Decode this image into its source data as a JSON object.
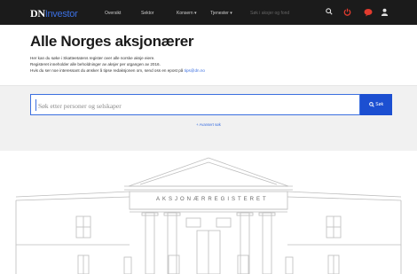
{
  "header": {
    "logo_dn": "DN",
    "logo_investor": "Investor",
    "nav": [
      {
        "label": "Oversikt"
      },
      {
        "label": "Sektor"
      },
      {
        "label": "Konsern ▾"
      },
      {
        "label": "Tjenester ▾"
      }
    ],
    "search_placeholder": "Søk i aksjer og fond",
    "icons": [
      "search-icon",
      "power-icon",
      "chat-icon",
      "user-icon"
    ]
  },
  "main": {
    "title": "Alle Norges aksjonærer",
    "intro_line1": "Her kan du søke i Skatteetatens register over alle norske aksje eiere.",
    "intro_line2": "Registeret inneholder alle beholdninger av aksjer per utgangen av 2016.",
    "intro_line3_text": "Hvis du ser noe interessant du ønsker å tipse redaksjonen om, send oss en epost på",
    "intro_email": "tips@dn.no"
  },
  "search": {
    "placeholder": "Søk etter personer og selskaper",
    "button_label": "Søk",
    "advanced_label": "+ Avansert søk"
  },
  "illustration": {
    "engraving": "AKSJONÆRREGISTERET"
  },
  "colors": {
    "topbar": "#1b1b1b",
    "accent": "#1c4fd1",
    "link": "#3b6fe0"
  }
}
